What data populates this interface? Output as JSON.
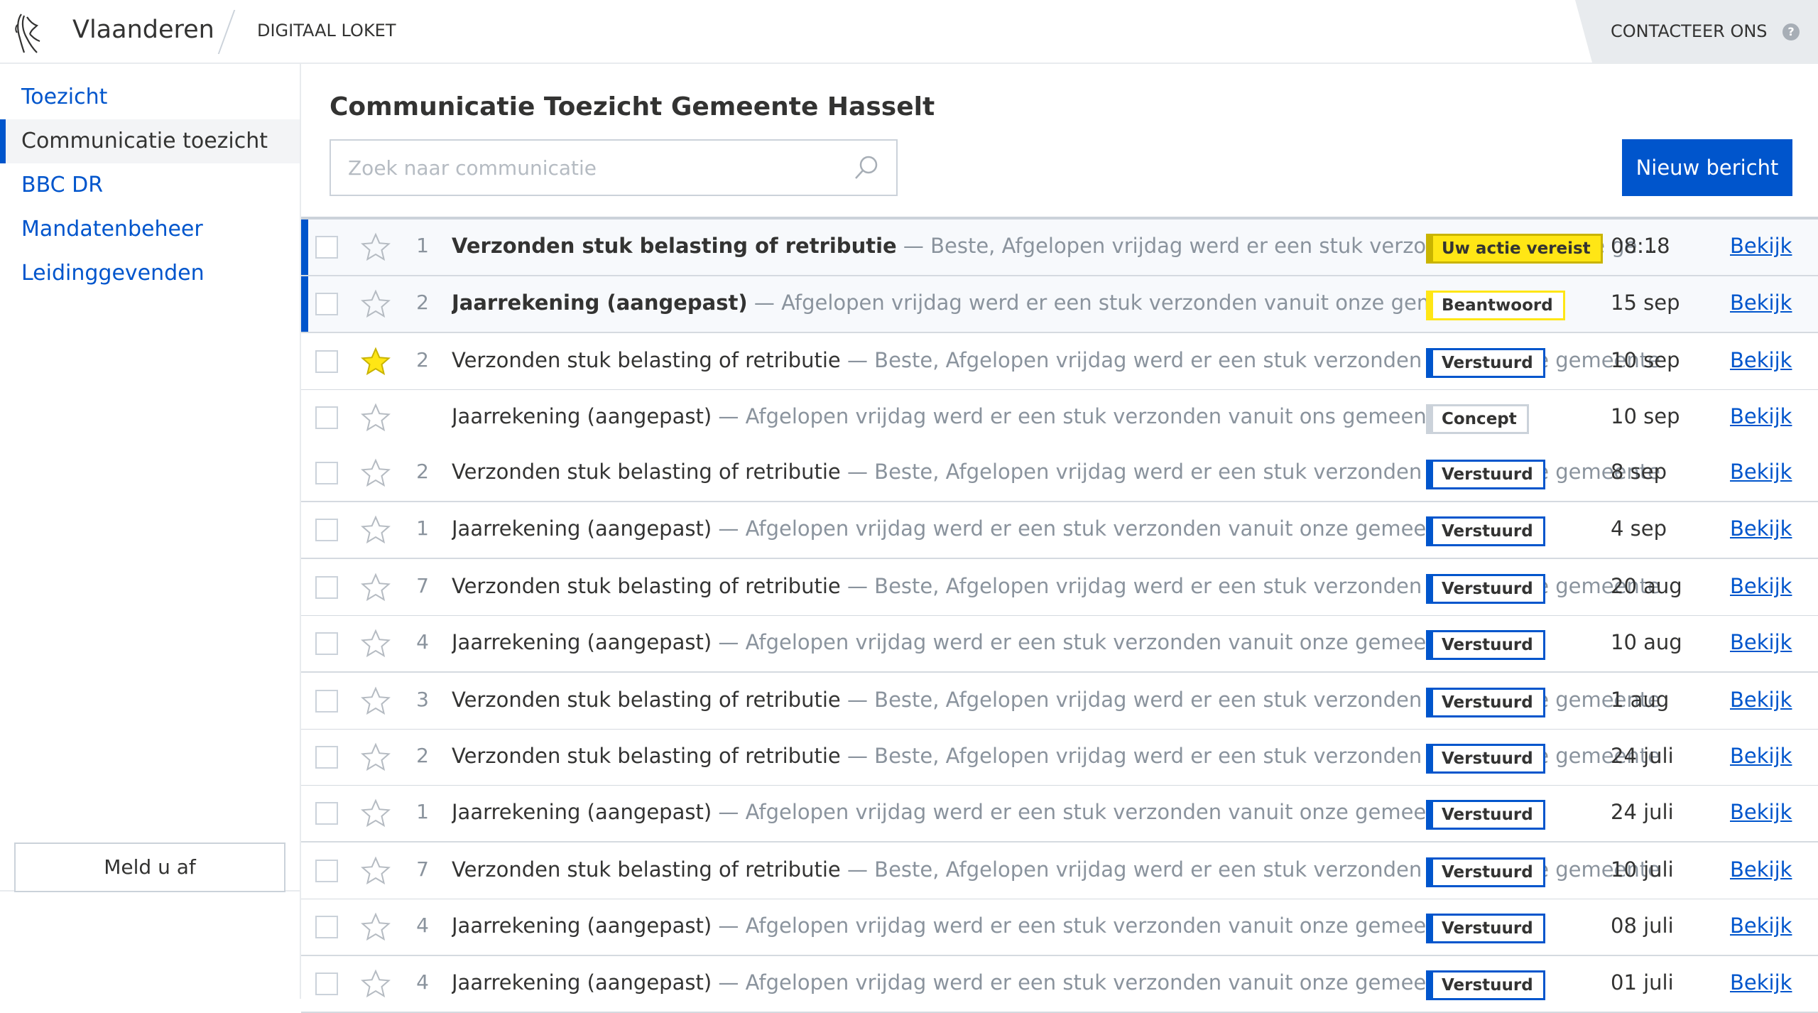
{
  "header": {
    "brand": "Vlaanderen",
    "section": "DIGITAAL LOKET",
    "contact": "CONTACTEER ONS",
    "help": "?"
  },
  "sidebar": {
    "items": [
      {
        "label": "Toezicht",
        "active": false
      },
      {
        "label": "Communicatie toezicht",
        "active": true
      },
      {
        "label": "BBC DR",
        "active": false
      },
      {
        "label": "Mandatenbeheer",
        "active": false
      },
      {
        "label": "Leidinggevenden",
        "active": false
      }
    ],
    "logout": "Meld u af"
  },
  "main": {
    "title": "Communicatie Toezicht Gemeente Hasselt",
    "search_placeholder": "Zoek naar communicatie",
    "new_button": "Nieuw bericht"
  },
  "colors": {
    "accent": "#0055cc",
    "star_active": "#ffe615",
    "badge_action": "#ffe615"
  },
  "messages": [
    {
      "count": "1",
      "subject": "Verzonden stuk belasting of retributie",
      "preview": " — Beste, Afgelopen vrijdag werd er een stuk verzonden vanuit onze gemeente",
      "status": "Uw actie vereist",
      "status_type": "action",
      "date": "08:18",
      "action": "Bekijk",
      "unread": true,
      "starred": false
    },
    {
      "count": "2",
      "subject": "Jaarrekening (aangepast)",
      "preview": " — Afgelopen vrijdag werd er een stuk verzonden vanuit onze gemeente",
      "status": "Beantwoord",
      "status_type": "answered",
      "date": "15 sep",
      "action": "Bekijk",
      "unread": true,
      "starred": false
    },
    {
      "count": "2",
      "subject": "Verzonden stuk belasting of retributie",
      "preview": " — Beste, Afgelopen vrijdag werd er een stuk verzonden vanuit onze gemeente",
      "status": "Verstuurd",
      "status_type": "sent",
      "date": "10 sep",
      "action": "Bekijk",
      "unread": false,
      "starred": true
    },
    {
      "count": "",
      "subject": "Jaarrekening (aangepast)",
      "preview": " — Afgelopen vrijdag werd er een stuk verzonden vanuit ons gemeentebestuur",
      "status": "Concept",
      "status_type": "concept",
      "date": "10 sep",
      "action": "Bekijk",
      "unread": false,
      "starred": false
    },
    {
      "count": "2",
      "subject": "Verzonden stuk belasting of retributie",
      "preview": " — Beste, Afgelopen vrijdag werd er een stuk verzonden vanuit onze gemeente",
      "status": "Verstuurd",
      "status_type": "sent",
      "date": "8 sep",
      "action": "Bekijk",
      "unread": false,
      "starred": false
    },
    {
      "count": "1",
      "subject": "Jaarrekening (aangepast)",
      "preview": " — Afgelopen vrijdag werd er een stuk verzonden vanuit onze gemeente",
      "status": "Verstuurd",
      "status_type": "sent",
      "date": "4 sep",
      "action": "Bekijk",
      "unread": false,
      "starred": false
    },
    {
      "count": "7",
      "subject": "Verzonden stuk belasting of retributie",
      "preview": " — Beste, Afgelopen vrijdag werd er een stuk verzonden vanuit onze gemeente",
      "status": "Verstuurd",
      "status_type": "sent",
      "date": "20 aug",
      "action": "Bekijk",
      "unread": false,
      "starred": false
    },
    {
      "count": "4",
      "subject": "Jaarrekening (aangepast)",
      "preview": " — Afgelopen vrijdag werd er een stuk verzonden vanuit onze gemeente",
      "status": "Verstuurd",
      "status_type": "sent",
      "date": "10 aug",
      "action": "Bekijk",
      "unread": false,
      "starred": false
    },
    {
      "count": "3",
      "subject": "Verzonden stuk belasting of retributie",
      "preview": " — Beste, Afgelopen vrijdag werd er een stuk verzonden vanuit onze gemeente",
      "status": "Verstuurd",
      "status_type": "sent",
      "date": "1 aug",
      "action": "Bekijk",
      "unread": false,
      "starred": false
    },
    {
      "count": "2",
      "subject": "Verzonden stuk belasting of retributie",
      "preview": " — Beste, Afgelopen vrijdag werd er een stuk verzonden vanuit onze gemeente",
      "status": "Verstuurd",
      "status_type": "sent",
      "date": "24 juli",
      "action": "Bekijk",
      "unread": false,
      "starred": false
    },
    {
      "count": "1",
      "subject": "Jaarrekening (aangepast)",
      "preview": " — Afgelopen vrijdag werd er een stuk verzonden vanuit onze gemeente",
      "status": "Verstuurd",
      "status_type": "sent",
      "date": "24 juli",
      "action": "Bekijk",
      "unread": false,
      "starred": false
    },
    {
      "count": "7",
      "subject": "Verzonden stuk belasting of retributie",
      "preview": " — Beste, Afgelopen vrijdag werd er een stuk verzonden vanuit onze gemeente",
      "status": "Verstuurd",
      "status_type": "sent",
      "date": "10 juli",
      "action": "Bekijk",
      "unread": false,
      "starred": false
    },
    {
      "count": "4",
      "subject": "Jaarrekening (aangepast)",
      "preview": " — Afgelopen vrijdag werd er een stuk verzonden vanuit onze gemeente",
      "status": "Verstuurd",
      "status_type": "sent",
      "date": "08 juli",
      "action": "Bekijk",
      "unread": false,
      "starred": false
    },
    {
      "count": "4",
      "subject": "Jaarrekening (aangepast)",
      "preview": " — Afgelopen vrijdag werd er een stuk verzonden vanuit onze gemeente",
      "status": "Verstuurd",
      "status_type": "sent",
      "date": "01 juli",
      "action": "Bekijk",
      "unread": false,
      "starred": false
    }
  ]
}
